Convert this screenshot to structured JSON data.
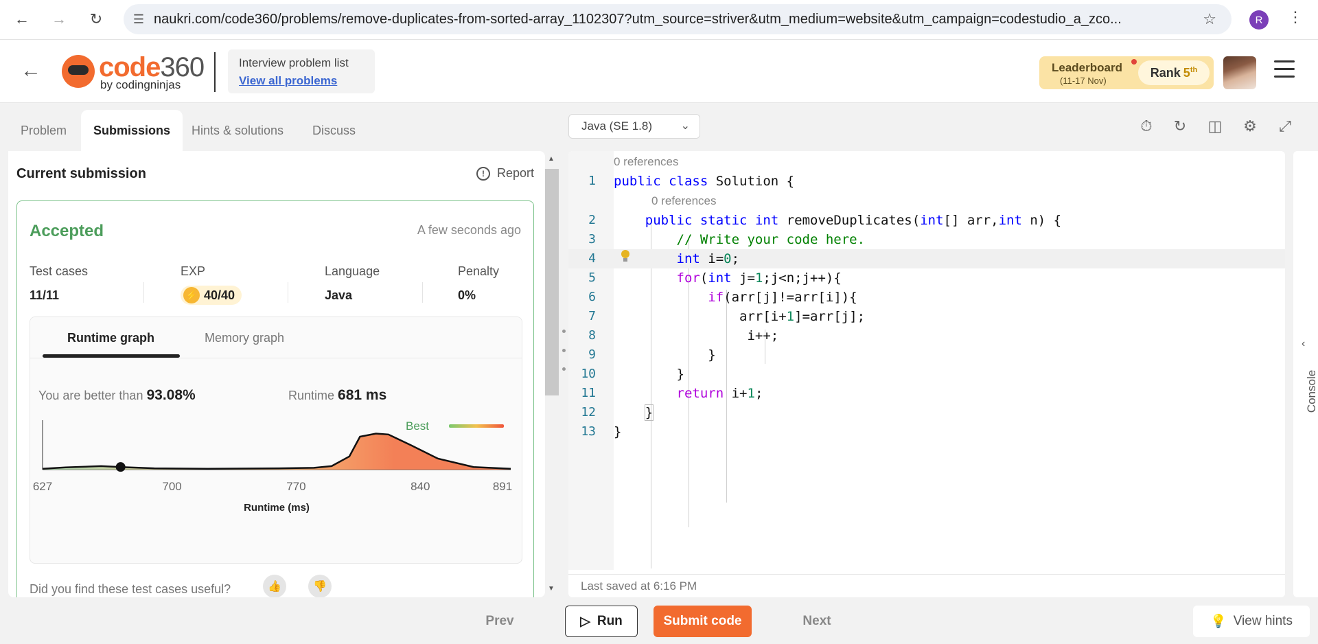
{
  "browser": {
    "url": "naukri.com/code360/problems/remove-duplicates-from-sorted-array_1102307?utm_source=striver&utm_medium=website&utm_campaign=codestudio_a_zco...",
    "profile_initial": "R"
  },
  "header": {
    "logo_word": "code",
    "logo_num": "360",
    "logo_sub": "by codingninjas",
    "problem_list_title": "Interview problem list",
    "problem_list_link": "View all problems",
    "leaderboard_label": "Leaderboard",
    "leaderboard_dates": "(11-17 Nov)",
    "rank_label": "Rank",
    "rank_value": "5",
    "rank_suffix": "th"
  },
  "tabs": [
    "Problem",
    "Submissions",
    "Hints & solutions",
    "Discuss"
  ],
  "submission": {
    "title": "Current submission",
    "report": "Report",
    "status": "Accepted",
    "time_ago": "A few seconds ago",
    "stats": {
      "test_cases_label": "Test cases",
      "test_cases": "11/11",
      "exp_label": "EXP",
      "exp": "40/40",
      "language_label": "Language",
      "language": "Java",
      "penalty_label": "Penalty",
      "penalty": "0%"
    },
    "graph_tabs": [
      "Runtime graph",
      "Memory graph"
    ],
    "better_label": "You are better than",
    "better_value": "93.08%",
    "runtime_label": "Runtime",
    "runtime_value": "681 ms",
    "legend_best": "Best",
    "useful_question": "Did you find these test cases useful?"
  },
  "chart_data": {
    "type": "area",
    "xlabel": "Runtime (ms)",
    "x_ticks": [
      "627",
      "700",
      "770",
      "840",
      "891"
    ],
    "xlim": [
      627,
      891
    ],
    "marker_x": 671,
    "series": [
      {
        "name": "",
        "color": "#a5d6a7",
        "x": [
          627,
          640,
          660,
          671,
          690,
          720,
          760,
          780,
          790,
          800,
          806,
          815,
          822,
          835,
          850,
          870,
          891
        ],
        "y": [
          0.02,
          0.05,
          0.08,
          0.06,
          0.03,
          0.02,
          0.03,
          0.04,
          0.08,
          0.3,
          0.75,
          0.82,
          0.8,
          0.55,
          0.25,
          0.06,
          0.02
        ]
      }
    ]
  },
  "editor": {
    "language": "Java (SE 1.8)",
    "references": "0 references",
    "last_saved": "Last saved at 6:16 PM",
    "console_label": "Console",
    "line_numbers": [
      "1",
      "2",
      "3",
      "4",
      "5",
      "6",
      "7",
      "8",
      "9",
      "10",
      "11",
      "12",
      "13"
    ]
  },
  "bottom": {
    "prev": "Prev",
    "run": "Run",
    "submit": "Submit code",
    "next": "Next",
    "view_hints": "View hints"
  },
  "colors": {
    "brand": "#f26b2f",
    "accepted": "#4c9d5b",
    "link": "#3b66d1"
  }
}
